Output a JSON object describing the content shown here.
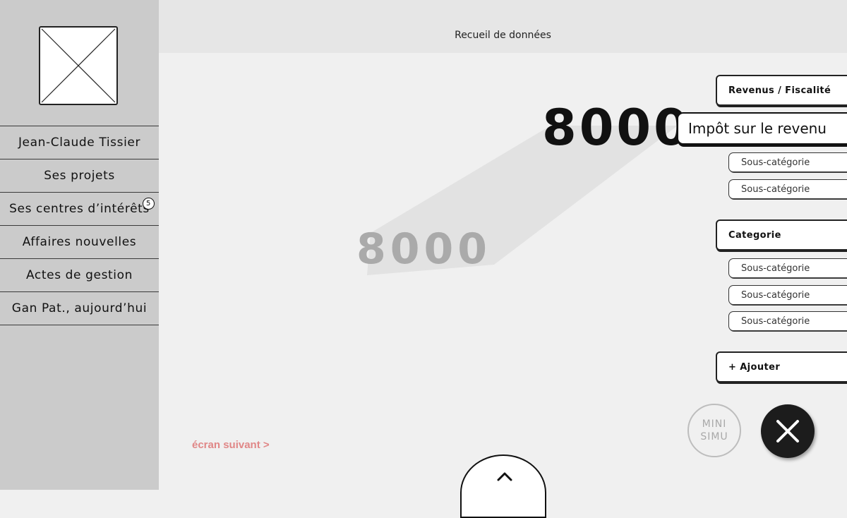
{
  "sidebar": {
    "logo_icon": "image-placeholder-icon",
    "items": [
      {
        "label": "Jean-Claude Tissier"
      },
      {
        "label": "Ses projets"
      },
      {
        "label": "Ses centres d’intérêts",
        "badge": "5"
      },
      {
        "label": "Affaires nouvelles"
      },
      {
        "label": "Actes de gestion"
      },
      {
        "label": "Gan Pat., aujourd’hui"
      }
    ]
  },
  "header": {
    "title": "Recueil de données"
  },
  "main": {
    "value": "8000",
    "ghost_value": "8000"
  },
  "panel": {
    "category_1": "Revenus / Fiscalité",
    "active_item": "Impôt sur le revenu",
    "sub_1": [
      "Sous-catégorie",
      "Sous-catégorie"
    ],
    "category_2": "Categorie",
    "sub_2": [
      "Sous-catégorie",
      "Sous-catégorie",
      "Sous-catégorie"
    ],
    "add_label": "+ Ajouter"
  },
  "footer": {
    "next_label": "écran suivant >",
    "mini_simu_line1": "MINI",
    "mini_simu_line2": "SIMU",
    "close_icon": "close-icon",
    "up_icon": "chevron-up-icon"
  },
  "colors": {
    "sidebar_bg": "#cbcbcb",
    "header_bg": "#e6e6e6",
    "content_bg": "#f0f0f0",
    "link_accent": "#e08787",
    "close_bg": "#1c1c1c"
  }
}
